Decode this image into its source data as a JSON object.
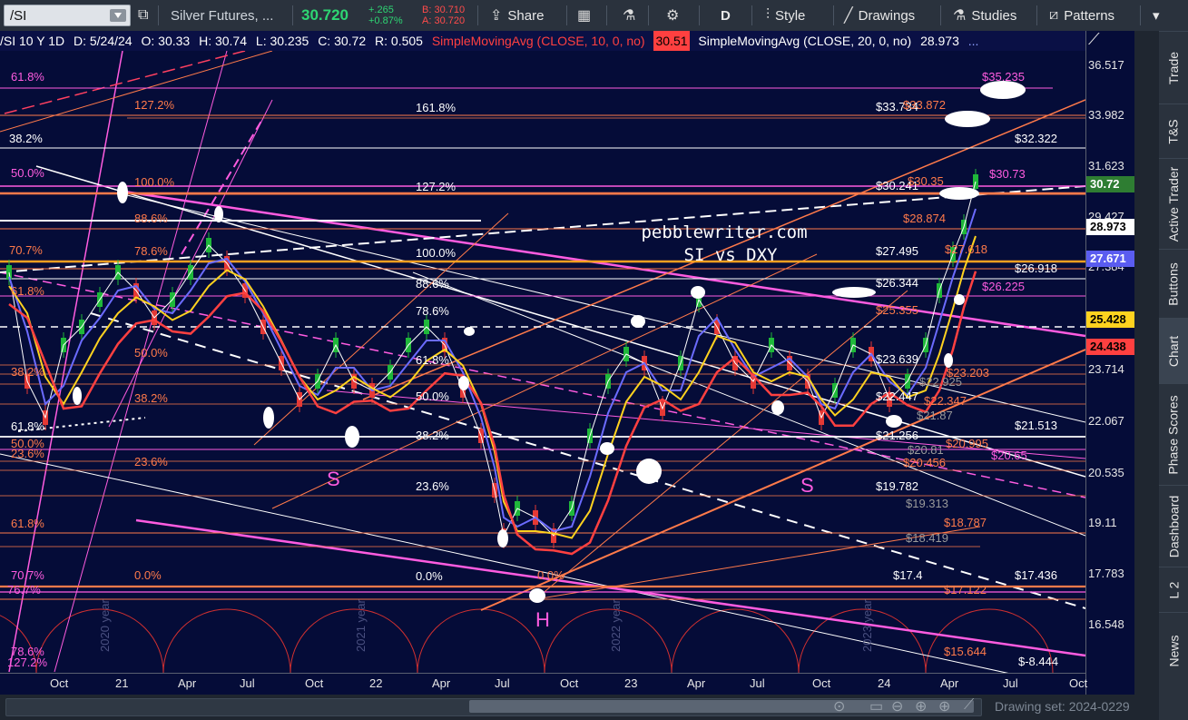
{
  "toolbar": {
    "symbol": "/SI",
    "description": "Silver Futures, ...",
    "last": "30.720",
    "change": "+.265",
    "change_pct": "+0.87%",
    "bid": "B: 30.710",
    "ask": "A: 30.720",
    "share": "Share",
    "aggregation": "D",
    "style": "Style",
    "drawings": "Drawings",
    "studies": "Studies",
    "patterns": "Patterns",
    "icons": [
      "share-icon",
      "calendar-icon",
      "flask-icon",
      "gear-icon",
      "candles-icon",
      "pencil-icon",
      "flask-icon",
      "patterns-icon"
    ]
  },
  "chart_header": {
    "info": "/SI 10 Y 1D",
    "date": "D: 5/24/24",
    "open": "O: 30.33",
    "high": "H: 30.74",
    "low": "L: 30.235",
    "close": "C: 30.72",
    "range": "R: 0.505",
    "sma10": "SimpleMovingAvg (CLOSE, 10, 0, no)",
    "sma10_val": "30.51",
    "sma20": "SimpleMovingAvg (CLOSE, 20, 0, no)",
    "sma20_val": "28.973",
    "more": "..."
  },
  "watermark": {
    "site": "pebblewriter.com",
    "title": "SI vs DXY"
  },
  "pattern_labels": {
    "left_shoulder": "S",
    "right_shoulder": "S",
    "head": "H"
  },
  "year_labels": [
    "2020 year",
    "2021 year",
    "2022 year",
    "2023 year"
  ],
  "price_axis": {
    "labels": [
      "36.517",
      "33.982",
      "31.623",
      "29.427",
      "27.384",
      "25.482",
      "23.714",
      "22.067",
      "20.535",
      "19.11",
      "17.783",
      "16.548"
    ],
    "tags": [
      {
        "value": "30.72",
        "color": "#2e7d32",
        "text_color": "#ffffff"
      },
      {
        "value": "28.973",
        "color": "#ffffff",
        "text_color": "#000000"
      },
      {
        "value": "27.671",
        "color": "#5a5cf0",
        "text_color": "#ffffff"
      },
      {
        "value": "25.428",
        "color": "#ffd21f",
        "text_color": "#000000"
      },
      {
        "value": "24.438",
        "color": "#ff4040",
        "text_color": "#000000"
      }
    ]
  },
  "x_axis": [
    "Oct",
    "21",
    "Apr",
    "Jul",
    "Oct",
    "22",
    "Apr",
    "Jul",
    "Oct",
    "23",
    "Apr",
    "Jul",
    "Oct",
    "24",
    "Apr",
    "Jul",
    "Oct"
  ],
  "fib_labels_white": [
    "161.8%",
    "127.2%",
    "100.0%",
    "88.6%",
    "78.6%",
    "61.8%",
    "50.0%",
    "38.2%",
    "23.6%",
    "0.0%",
    "38.2%",
    "61.8%"
  ],
  "fib_labels_pink": [
    "61.8%",
    "50.0%",
    "70.7%",
    "76.7%",
    "78.6%",
    "127.2%"
  ],
  "fib_labels_orange": [
    "127.2%",
    "100.0%",
    "88.6%",
    "78.6%",
    "50.0%",
    "38.2%",
    "23.6%",
    "61.8%",
    "70.7%",
    "0.0%",
    "38.2%",
    "61.8%",
    "50.0%",
    "23.6%",
    "0.0%"
  ],
  "price_targets": {
    "white": [
      "$33.734",
      "$30.241",
      "$27.495",
      "$26.344",
      "$23.639",
      "$22.447",
      "$21.256",
      "$19.782",
      "$17.4",
      "$32.322",
      "$26.918",
      "$21.513",
      "$17.436",
      "$-8.444"
    ],
    "orange": [
      "$33.872",
      "$30.35",
      "$28.874",
      "$25.355",
      "$23.203",
      "$22.347",
      "$20.995",
      "$20.456",
      "$18.787",
      "$17.122",
      "$15.644",
      "$27.618"
    ],
    "pink": [
      "$35.235",
      "$30.73",
      "$26.225",
      "$20.65"
    ],
    "gray": [
      "$21.87",
      "$20.81",
      "$19.313",
      "$18.419",
      "$22.925"
    ]
  },
  "sidetabs": [
    "Trade",
    "T&S",
    "Active Trader",
    "Buttons",
    "Chart",
    "Phase Scores",
    "Dashboard",
    "L 2",
    "News"
  ],
  "active_tab": "Chart",
  "bottom": {
    "drawing_set": "Drawing set: 2024-0229",
    "icons": [
      "reset-zoom-icon",
      "zoom-out-icon",
      "zoom-in-icon",
      "magnifier-icon",
      "drawing-icon"
    ]
  },
  "colors": {
    "chart_bg": "#050c38",
    "pink": "#ff5ce0",
    "orange": "#ff7a4a",
    "white": "#ffffff",
    "sma_blue": "#6b6bff",
    "sma_yellow": "#ffd21f",
    "sma_red": "#ff4040",
    "bull": "#1fb83a",
    "bear": "#e53935"
  }
}
